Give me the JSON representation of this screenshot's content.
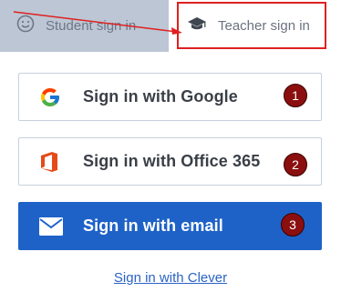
{
  "tabs": {
    "student_label": "Student sign in",
    "teacher_label": "Teacher sign in"
  },
  "buttons": {
    "google_label": "Sign in with Google",
    "office_label": "Sign in with Office 365",
    "email_label": "Sign in with email"
  },
  "badges": {
    "one": "1",
    "two": "2",
    "three": "3"
  },
  "links": {
    "clever_label": "Sign in with Clever"
  },
  "colors": {
    "email_button": "#1e62c8",
    "highlight": "#e02020",
    "badge": "#8b0f0f",
    "student_tab": "#bcc6d4"
  },
  "icons": {
    "student_tab": "smiley-icon",
    "teacher_tab": "graduation-cap-icon",
    "google": "google-g-icon",
    "office": "office-365-icon",
    "email": "envelope-icon"
  }
}
